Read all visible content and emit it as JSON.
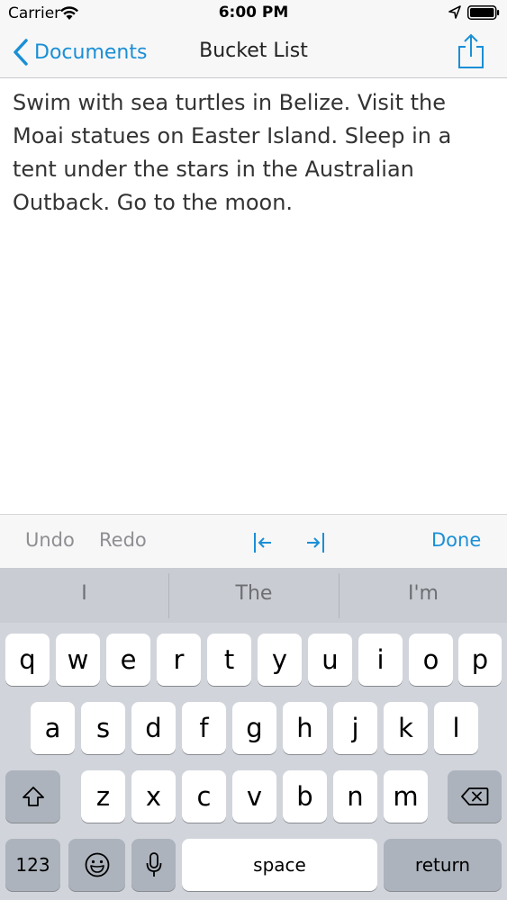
{
  "status_bar": {
    "carrier": "Carrier",
    "time": "6:00 PM",
    "icons": [
      "wifi-icon",
      "location-icon",
      "battery-icon"
    ]
  },
  "nav": {
    "back_label": "Documents",
    "title": "Bucket List",
    "share_icon": "share-icon"
  },
  "document": {
    "text": "Swim with sea turtles in Belize. Visit the Moai statues on Easter Island. Sleep in a tent under the stars in the Australian Outback. Go to the moon."
  },
  "toolbar": {
    "undo": "Undo",
    "redo": "Redo",
    "done": "Done",
    "indent_left_icon": "indent-left-icon",
    "indent_right_icon": "indent-right-icon"
  },
  "keyboard": {
    "suggestions": [
      "I",
      "The",
      "I'm"
    ],
    "row1": [
      "q",
      "w",
      "e",
      "r",
      "t",
      "y",
      "u",
      "i",
      "o",
      "p"
    ],
    "row2": [
      "a",
      "s",
      "d",
      "f",
      "g",
      "h",
      "j",
      "k",
      "l"
    ],
    "row3": [
      "z",
      "x",
      "c",
      "v",
      "b",
      "n",
      "m"
    ],
    "numbers_label": "123",
    "space_label": "space",
    "return_label": "return"
  },
  "colors": {
    "accent": "#1a8fd6",
    "disabled": "#8e8e93",
    "keyboard_bg": "#d1d5db",
    "dark_key": "#acb3bc"
  }
}
